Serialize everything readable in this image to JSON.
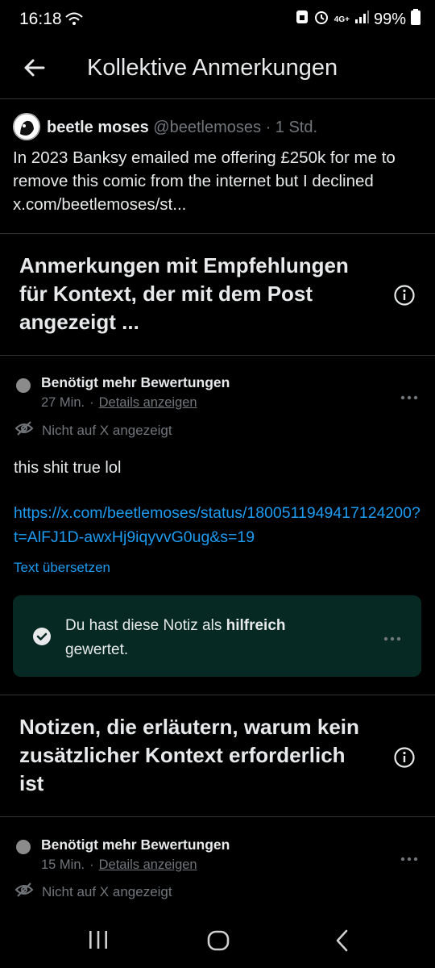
{
  "status_bar": {
    "time": "16:18",
    "network": "4G+",
    "battery": "99%"
  },
  "header": {
    "title": "Kollektive Anmerkungen"
  },
  "tweet": {
    "name": "beetle moses",
    "handle": "@beetlemoses",
    "time": "· 1 Std.",
    "text": "In 2023 Banksy emailed me offering £250k for me to remove this comic from the internet but I declined x.com/beetlemoses/st..."
  },
  "section1": {
    "title": "Anmerkungen mit Empfehlungen für Kontext, der mit dem Post angezeigt ..."
  },
  "note1": {
    "status": "Benötigt mehr Bewertungen",
    "age": "27 Min.",
    "sep": "·",
    "details": "Details anzeigen",
    "not_shown": "Nicht auf X angezeigt",
    "text": "this shit true lol",
    "link": "https://x.com/beetlemoses/status/1800511949417124200?t=AlFJ1D-awxHj9iqyvvG0ug&s=19",
    "translate": "Text übersetzen",
    "rated_pre": "Du hast diese Notiz als ",
    "rated_bold": "hilfreich",
    "rated_post": " gewertet."
  },
  "section2": {
    "title": "Notizen, die erläutern, warum kein zusätzlicher Kontext erforderlich ist"
  },
  "note2": {
    "status": "Benötigt mehr Bewertungen",
    "age": "15 Min.",
    "sep": "·",
    "details": "Details anzeigen",
    "not_shown": "Nicht auf X angezeigt"
  },
  "colors": {
    "background": "#000000",
    "accent": "#1d9bf0",
    "rated_bg": "#062a23",
    "muted": "#71767b"
  }
}
